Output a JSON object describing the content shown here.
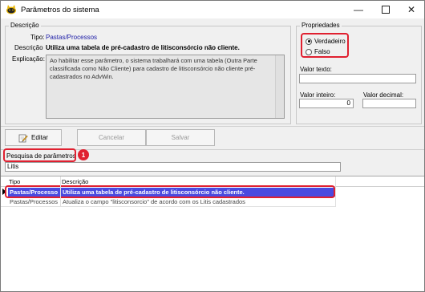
{
  "window": {
    "title": "Parâmetros do sistema"
  },
  "descricao": {
    "group_label": "Descrição",
    "tipo_label": "Tipo:",
    "tipo_value": "Pastas/Processos",
    "descricao_label": "Descrição",
    "descricao_value": "Utiliza uma tabela de pré-cadastro de litisconsórcio não cliente.",
    "explicacao_label": "Explicação:",
    "explicacao_value": "Ao habilitar esse parâmetro, o sistema trabalhará com uma tabela (Outra Parte classificada como Não Cliente) para cadastro de litisconsórcio não cliente pré-cadastrados no AdvWin."
  },
  "propriedades": {
    "group_label": "Propriedades",
    "option_true": "Verdadeiro",
    "option_false": "Falso",
    "selected": "Verdadeiro",
    "valor_texto_label": "Valor texto:",
    "valor_texto_value": "",
    "valor_inteiro_label": "Valor inteiro:",
    "valor_inteiro_value": "0",
    "valor_decimal_label": "Valor decimal:",
    "valor_decimal_value": ""
  },
  "toolbar": {
    "editar": "Editar",
    "cancelar": "Cancelar",
    "salvar": "Salvar"
  },
  "search": {
    "label": "Pesquisa de parâmetros",
    "value": "Litis",
    "badge": "1"
  },
  "grid": {
    "columns": [
      "Tipo",
      "Descrição"
    ],
    "rows": [
      {
        "tipo": "Pastas/Processo",
        "descricao": "Utiliza uma tabela de pré-cadastro de litisconsórcio não cliente.",
        "selected": true
      },
      {
        "tipo": "Pastas/Processos",
        "descricao": "Atualiza o campo \"litisconsorcio\" de acordo com os Litis cadastrados",
        "selected": false
      }
    ]
  },
  "colors": {
    "selection": "#4a4ae0",
    "annotation": "#e02030",
    "link_blue": "#1a1aa6"
  },
  "icons": {
    "app": "cat-logo-icon",
    "edit": "pencil-paper-icon",
    "row_pointer": "triangle-right-icon"
  }
}
